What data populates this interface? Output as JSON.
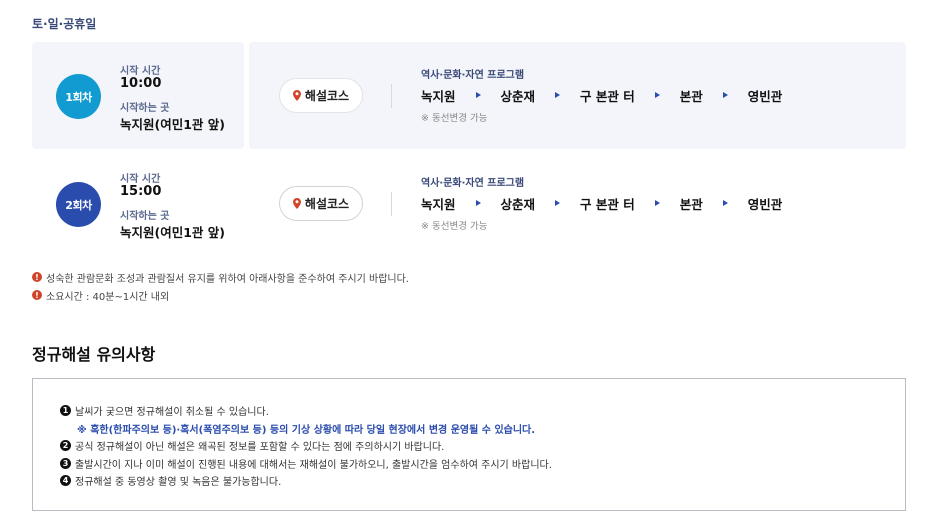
{
  "day_label": "토·일·공휴일",
  "labels": {
    "start_time": "시작 시간",
    "start_place": "시작하는 곳",
    "course": "해설코스",
    "program_title": "역사·문화·자연 프로그램",
    "route_note": "※ 동선변경 가능"
  },
  "sessions": [
    {
      "round": "1회차",
      "start_time": "10:00",
      "start_place": "녹지원(여민1관 앞)",
      "route": [
        "녹지원",
        "상춘재",
        "구 본관 터",
        "본관",
        "영빈관"
      ]
    },
    {
      "round": "2회차",
      "start_time": "15:00",
      "start_place": "녹지원(여민1관 앞)",
      "route": [
        "녹지원",
        "상춘재",
        "구 본관 터",
        "본관",
        "영빈관"
      ]
    }
  ],
  "notices": [
    "성숙한 관람문화 조성과 관람질서 유지를 위하여 아래사항을 준수하여 주시기 바랍니다.",
    "소요시간 : 40분~1시간 내외"
  ],
  "notice_icon": "!",
  "section_title": "정규해설 유의사항",
  "rules": [
    {
      "num": "1",
      "text": "날씨가 궂으면 정규해설이 취소될 수 있습니다."
    },
    {
      "num": "2",
      "text": "공식 정규해설이 아닌 해설은 왜곡된 정보를 포함할 수 있다는 점에 주의하시기 바랍니다."
    },
    {
      "num": "3",
      "text": "출발시간이 지나 이미 해설이 진행된 내용에 대해서는 재해설이 불가하오니, 출발시간을 엄수하여 주시기 바랍니다."
    },
    {
      "num": "4",
      "text": "정규해설 중 동영상 촬영 및 녹음은 불가능합니다."
    }
  ],
  "rule_sub": "※ 혹한(한파주의보 등)·혹서(폭염주의보 등) 등의 기상 상황에 따라 당일 현장에서 변경 운영될 수 있습니다.",
  "colors": {
    "round1": "#119bd0",
    "round2": "#2a4cad",
    "accent_text": "#2a4cad",
    "notice_icon": "#d0442a",
    "pin": "#d0442a"
  },
  "icons": {
    "pin": "location-pin-icon",
    "arrow": "triangle-right-icon",
    "notice": "exclamation-circle-icon"
  }
}
